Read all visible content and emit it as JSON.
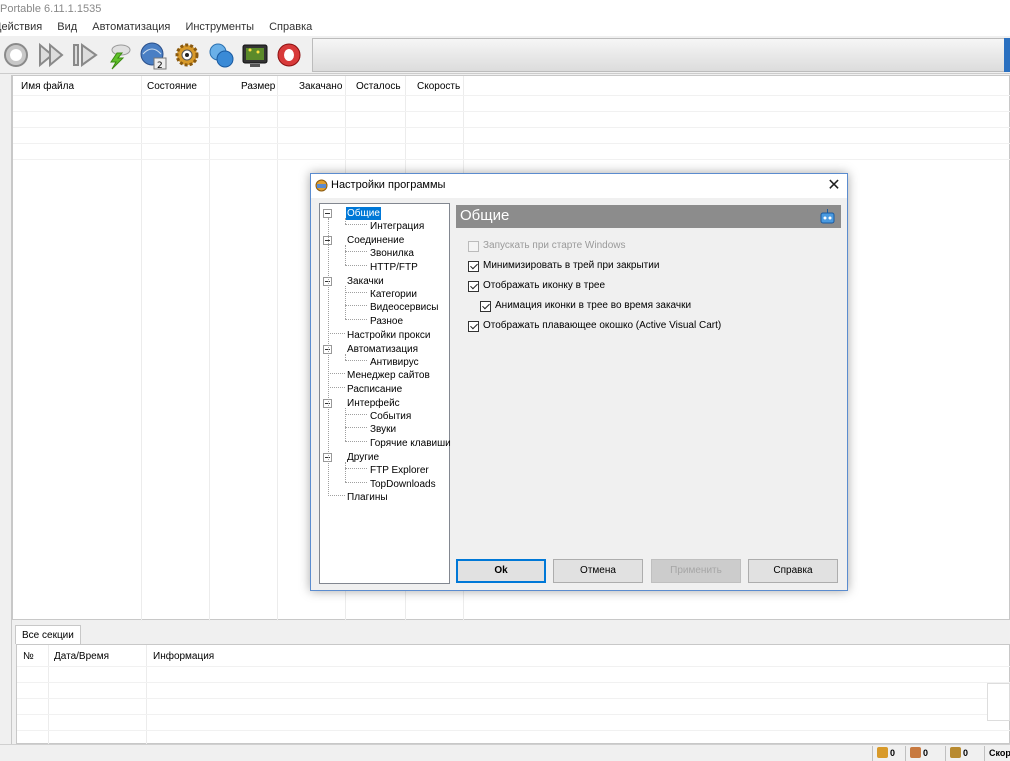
{
  "app": {
    "title": "Portable 6.11.1.1535",
    "menu": [
      "Действия",
      "Вид",
      "Автоматизация",
      "Инструменты",
      "Справка"
    ]
  },
  "toolbar": {
    "icons": [
      "stop-icon",
      "resume-all-icon",
      "resume-icon",
      "speed-icon",
      "schedule-icon",
      "settings-icon",
      "sites-icon",
      "monitor-icon",
      "help-icon"
    ]
  },
  "downloads": {
    "columns": [
      "Имя файла",
      "Состояние",
      "Размер",
      "Закачано",
      "Осталось",
      "Скорость"
    ]
  },
  "log": {
    "tab": "Все секции",
    "columns": [
      "№",
      "Дата/Время",
      "Информация"
    ]
  },
  "statusbar": {
    "items": [
      "0",
      "0",
      "0",
      "Скор"
    ]
  },
  "dialog": {
    "title": "Настройки программы",
    "tree": [
      {
        "label": "Общие",
        "level": 0,
        "selected": true
      },
      {
        "label": "Интеграция",
        "level": 1
      },
      {
        "label": "Соединение",
        "level": 0
      },
      {
        "label": "Звонилка",
        "level": 1
      },
      {
        "label": "HTTP/FTP",
        "level": 1
      },
      {
        "label": "Закачки",
        "level": 0
      },
      {
        "label": "Категории",
        "level": 1
      },
      {
        "label": "Видеосервисы",
        "level": 1
      },
      {
        "label": "Разное",
        "level": 1
      },
      {
        "label": "Настройки прокси",
        "level": 0
      },
      {
        "label": "Автоматизация",
        "level": 0
      },
      {
        "label": "Антивирус",
        "level": 1
      },
      {
        "label": "Менеджер сайтов",
        "level": 0
      },
      {
        "label": "Расписание",
        "level": 0
      },
      {
        "label": "Интерфейс",
        "level": 0
      },
      {
        "label": "События",
        "level": 1
      },
      {
        "label": "Звуки",
        "level": 1
      },
      {
        "label": "Горячие клавиши",
        "level": 1
      },
      {
        "label": "Другие",
        "level": 0
      },
      {
        "label": "FTP Explorer",
        "level": 1
      },
      {
        "label": "TopDownloads",
        "level": 1
      },
      {
        "label": "Плагины",
        "level": 0
      }
    ],
    "pane_title": "Общие",
    "options": [
      {
        "label": "Запускать при старте Windows",
        "checked": false,
        "disabled": true
      },
      {
        "label": "Минимизировать в трей при закрытии",
        "checked": true
      },
      {
        "label": "Отображать иконку в трее",
        "checked": true
      },
      {
        "label": "Анимация иконки в трее во время закачки",
        "checked": true
      },
      {
        "label": "Отображать плавающее окошко (Active Visual Cart)",
        "checked": true
      }
    ],
    "buttons": {
      "ok": "Ok",
      "cancel": "Отмена",
      "apply": "Применить",
      "help": "Справка"
    }
  }
}
